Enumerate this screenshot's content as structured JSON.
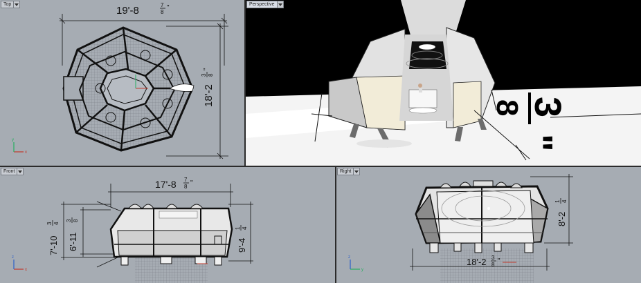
{
  "viewports": {
    "top": {
      "title": "Top",
      "dim_width": "19'-8",
      "dim_width_num": "7",
      "dim_width_den": "8",
      "dim_height": "18'-2",
      "dim_height_num": "3",
      "dim_height_den": "8",
      "axis_x": "x",
      "axis_y": "y"
    },
    "perspective": {
      "title": "Perspective",
      "dim_num": "3",
      "dim_den": "8",
      "dim_mark": "\""
    },
    "front": {
      "title": "Front",
      "dim_width": "17'-8",
      "dim_width_num": "7",
      "dim_width_den": "8",
      "dim_left_outer": "7'-10",
      "dim_left_outer_num": "3",
      "dim_left_outer_den": "4",
      "dim_left_inner": "6'-11",
      "dim_left_inner_num": "3",
      "dim_left_inner_den": "8",
      "dim_right": "9'-4",
      "dim_right_num": "1",
      "dim_right_den": "4",
      "axis_x": "x",
      "axis_z": "z"
    },
    "right": {
      "title": "Right",
      "dim_height": "8'-2",
      "dim_height_num": "1",
      "dim_height_den": "4",
      "dim_width": "18'-2",
      "dim_width_num": "3",
      "dim_width_den": "8",
      "axis_y": "y",
      "axis_z": "z"
    }
  },
  "colors": {
    "viewport_bg": "#a6acb3",
    "perspective_sky": "#000000",
    "perspective_ground": "#ffffff",
    "axis_x": "#c0392b",
    "axis_y": "#27ae60",
    "axis_z": "#2c5fc9"
  }
}
